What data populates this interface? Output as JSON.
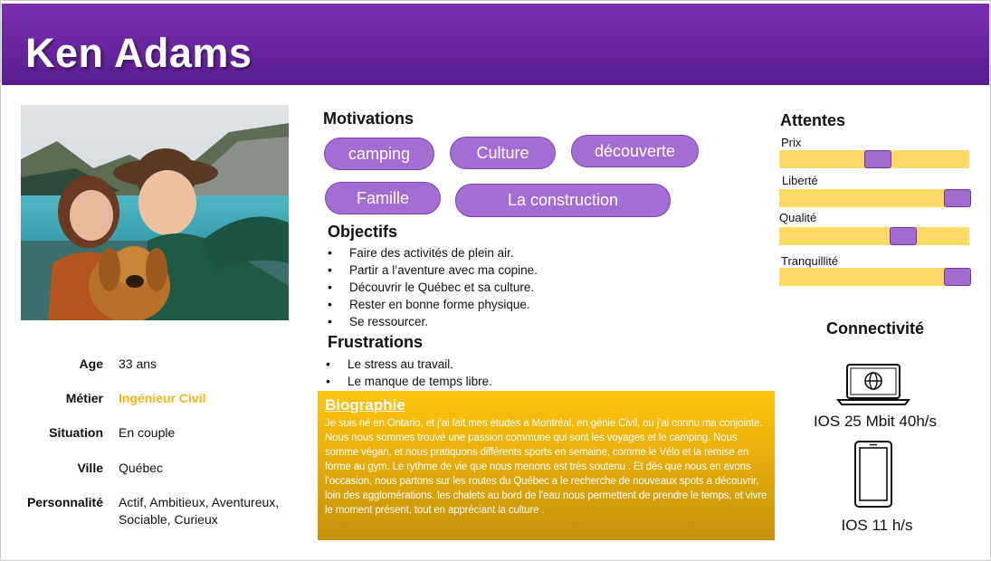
{
  "header": {
    "name": "Ken Adams",
    "color": "#6a26a0"
  },
  "profile": {
    "rows": [
      {
        "label": "Age",
        "value": "33 ans"
      },
      {
        "label": "Métier",
        "value": "Ingénieur Civil"
      },
      {
        "label": "Situation",
        "value": "En couple"
      },
      {
        "label": "Ville",
        "value": "Québec"
      },
      {
        "label": "Personnalité",
        "value_line1": "Actif, Ambitieux, Aventureux,",
        "value_line2": "Sociable, Curieux"
      }
    ]
  },
  "motivations": {
    "title": "Motivations",
    "items": [
      "camping",
      "Culture",
      "découverte",
      "Famille",
      "La construction"
    ]
  },
  "objectifs": {
    "title": "Objectifs",
    "items": [
      "Faire des activités de plein air.",
      "Partir a l’aventure avec ma copine.",
      "Découvrir le Québec et sa culture.",
      "Rester en bonne forme physique.",
      "Se ressourcer."
    ]
  },
  "frustrations": {
    "title": "Frustrations",
    "items": [
      "Le stress au travail.",
      "Le manque de temps libre."
    ]
  },
  "biographie": {
    "title": "Biographie",
    "text": "Je suis né en Ontario, et j’ai fait mes études a Montréal, en génie Civil, ou j’ai connu ma conjointe. Nous nous sommes trouvé une passion commune qui sont les voyages et le camping. Nous somme végan, et nous pratiquons différents sports en semaine, comme le Vélo  et la remise en forme au gym. Le rythme de vie que nous menons est très soutenu . Et dès que nous en avons l’occasion, nous partons sur les routes du Québec a le recherche de nouveaux spots a découvrir, loin des agglomérations.  les chalets au bord de l’eau nous permettent de prendre le temps, et vivre le moment présent, tout en appréciant la culture ."
  },
  "attentes": {
    "title": "Attentes",
    "items": [
      {
        "label": "Prix",
        "level": 0.52
      },
      {
        "label": "Liberté",
        "level": 0.95
      },
      {
        "label": "Qualité",
        "level": 0.65
      },
      {
        "label": "Tranquillité",
        "level": 0.95
      }
    ]
  },
  "connectivite": {
    "title": "Connectivité",
    "laptop": {
      "icon": "laptop-globe-icon",
      "text": "IOS 25 Mbit 40h/s"
    },
    "phone": {
      "icon": "smartphone-icon",
      "text": "IOS 11 h/s"
    }
  },
  "colors": {
    "pill": "#a46dd4",
    "bar": "#ffd966",
    "knob": "#a16bd0",
    "accent": "#f2b21b"
  }
}
